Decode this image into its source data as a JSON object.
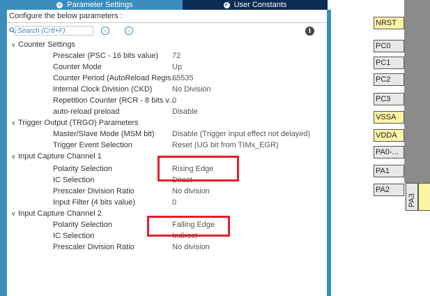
{
  "tabs": [
    {
      "label": "Parameter Settings",
      "icon": "check-circle-icon"
    },
    {
      "label": "User Constants",
      "icon": "check-circle-icon"
    }
  ],
  "configure_label": "Configure the below parameters :",
  "search": {
    "placeholder": "Search (Crtl+F)",
    "value": ""
  },
  "groups": [
    {
      "title": "Counter Settings",
      "params": [
        {
          "name": "Prescaler (PSC - 16 bits value)",
          "value": "72"
        },
        {
          "name": "Counter Mode",
          "value": "Up"
        },
        {
          "name": "Counter Period (AutoReload Regis...",
          "value": "65535"
        },
        {
          "name": "Internal Clock Division (CKD)",
          "value": "No Division"
        },
        {
          "name": "Repetition Counter (RCR - 8 bits v...",
          "value": "0"
        },
        {
          "name": "auto-reload preload",
          "value": "Disable"
        }
      ]
    },
    {
      "title": "Trigger Output (TRGO) Parameters",
      "params": [
        {
          "name": "Master/Slave Mode (MSM bit)",
          "value": "Disable (Trigger input effect not delayed)"
        },
        {
          "name": "Trigger Event Selection",
          "value": "Reset (UG bit from TIMx_EGR)"
        }
      ]
    },
    {
      "title": "Input Capture Channel 1",
      "params": [
        {
          "name": "Polarity Selection",
          "value": "Rising Edge"
        },
        {
          "name": "IC Selection",
          "value": "Direct"
        },
        {
          "name": "Prescaler Division Ratio",
          "value": "No division"
        },
        {
          "name": "Input Filter (4 bits value)",
          "value": "0"
        }
      ]
    },
    {
      "title": "Input Capture Channel 2",
      "params": [
        {
          "name": "Polarity Selection",
          "value": "Falling Edge"
        },
        {
          "name": "IC Selection",
          "value": "Indirect"
        },
        {
          "name": "Prescaler Division Ratio",
          "value": "No division"
        }
      ]
    }
  ],
  "pins": [
    {
      "label": "NRST",
      "highlight": true
    },
    {
      "label": "PC0",
      "highlight": false
    },
    {
      "label": "PC1",
      "highlight": false
    },
    {
      "label": "PC2",
      "highlight": false
    },
    {
      "label": "PC3",
      "highlight": false
    },
    {
      "label": "VSSA",
      "highlight": true
    },
    {
      "label": "VDDA",
      "highlight": true
    },
    {
      "label": "PA0-...",
      "highlight": false
    },
    {
      "label": "PA1",
      "highlight": false
    },
    {
      "label": "PA2",
      "highlight": false
    }
  ],
  "bottom_pins": [
    {
      "label": "PA3"
    }
  ],
  "colors": {
    "accent": "#3c8dbc",
    "tab_active": "#3c8dbc",
    "tab_inactive": "#0b2c53",
    "highlight_box": "#e0202a",
    "pin_power": "#fdf5a6"
  }
}
